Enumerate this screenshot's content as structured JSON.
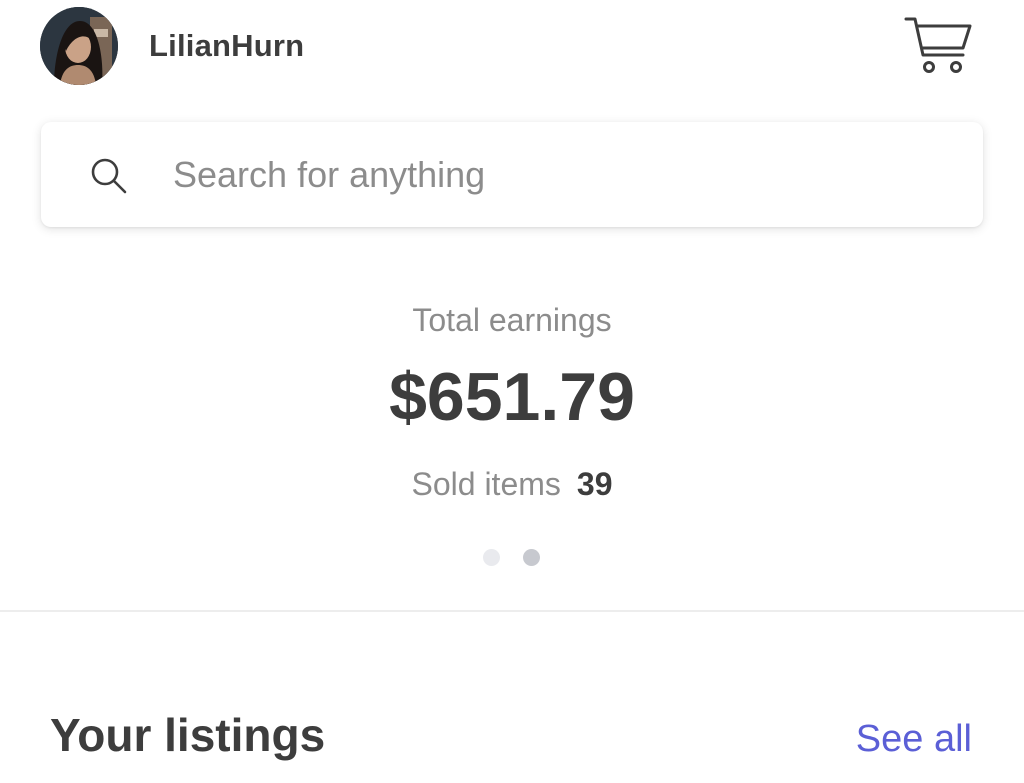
{
  "header": {
    "username": "LilianHurn",
    "avatar_icon": "user-avatar",
    "cart_icon": "shopping-cart-icon"
  },
  "search": {
    "placeholder": "Search for anything",
    "value": "",
    "icon": "search-icon"
  },
  "earnings": {
    "label": "Total earnings",
    "value": "$651.79",
    "sold_label": "Sold items",
    "sold_count": "39"
  },
  "pager": {
    "total_pages": 2,
    "active_page": 2
  },
  "listings": {
    "title": "Your listings",
    "see_all_label": "See all"
  },
  "colors": {
    "text_primary": "#3d3d3d",
    "text_secondary": "#8c8c8c",
    "link": "#5b5fd6",
    "dot_inactive": "#e9eaee",
    "dot_active": "#c7c9cf"
  }
}
